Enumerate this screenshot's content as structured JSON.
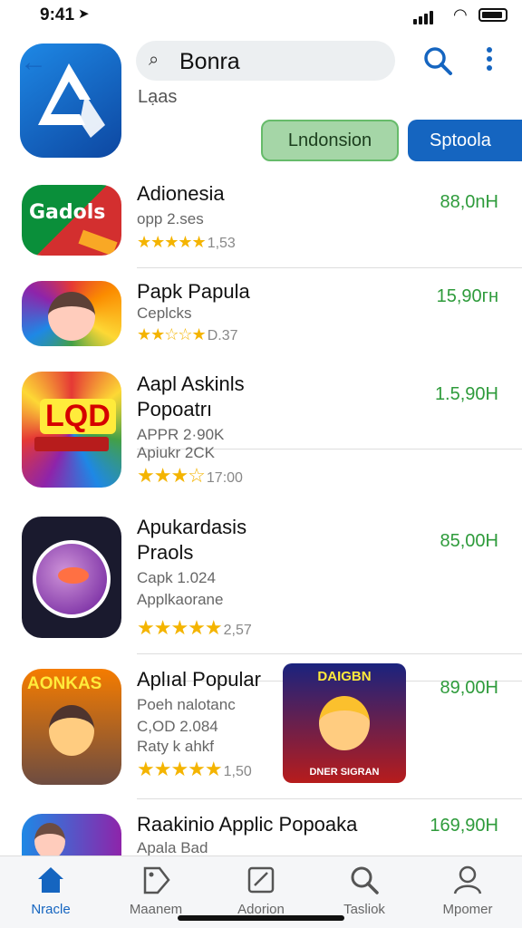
{
  "status_bar": {
    "time": "9:41"
  },
  "header": {
    "search_value": "Bonra",
    "subtitle": "Lạas",
    "chips": [
      "Lndonsion",
      "Sptoola"
    ]
  },
  "apps": [
    {
      "name": "Adionesia",
      "meta1": "opp 2.ses",
      "meta2": "",
      "stars": "★★★★★",
      "rating": "1,53",
      "price": "88,0nH",
      "icon_text": "Gadols"
    },
    {
      "name": "Papk Papula",
      "meta1": "Ceplcks",
      "meta2": "",
      "stars": "★★☆☆★",
      "rating": "D.37",
      "price": "15,90гн"
    },
    {
      "name": "Aapl Askinls\nPopoatrı",
      "meta1": "ΑΡΡR 2·90K",
      "meta2": "Apiukr 2CK",
      "stars": "★★★☆",
      "rating": "17:00",
      "price": "1.5,90H",
      "icon_text": "LQD"
    },
    {
      "name": "Apukardasis\nPraols",
      "meta1": "Capk 1.024",
      "meta2": "Applkaorane",
      "stars": "★★★★★",
      "rating": "2,57",
      "price": "85,00H"
    },
    {
      "name": "Aplıal Popular",
      "meta1": "Poeh nalotanc",
      "meta2": "C,OD 2.084",
      "meta3": "Raty k ahkf",
      "stars": "★★★★★",
      "rating": "1,50",
      "price": "89,00H",
      "icon_text": "AONKAS",
      "shot_text": "DAIGBN",
      "shot_caption": "DNER SIGRAN"
    },
    {
      "name": "Raakinio Applic Popoaka",
      "meta1": "Apala Bad",
      "meta2": "",
      "stars": "",
      "rating": "",
      "price": "169,90H"
    }
  ],
  "tabs": [
    {
      "label": "Nracle",
      "icon": "home-icon"
    },
    {
      "label": "Maanem",
      "icon": "tag-icon"
    },
    {
      "label": "Adorion",
      "icon": "edit-icon"
    },
    {
      "label": "Tasliok",
      "icon": "search-icon"
    },
    {
      "label": "Mpomer",
      "icon": "person-icon"
    }
  ],
  "colors": {
    "accent": "#1565c0",
    "price": "#2e9b3b",
    "star": "#f4b400",
    "chip_green": "#a5d6a7"
  }
}
